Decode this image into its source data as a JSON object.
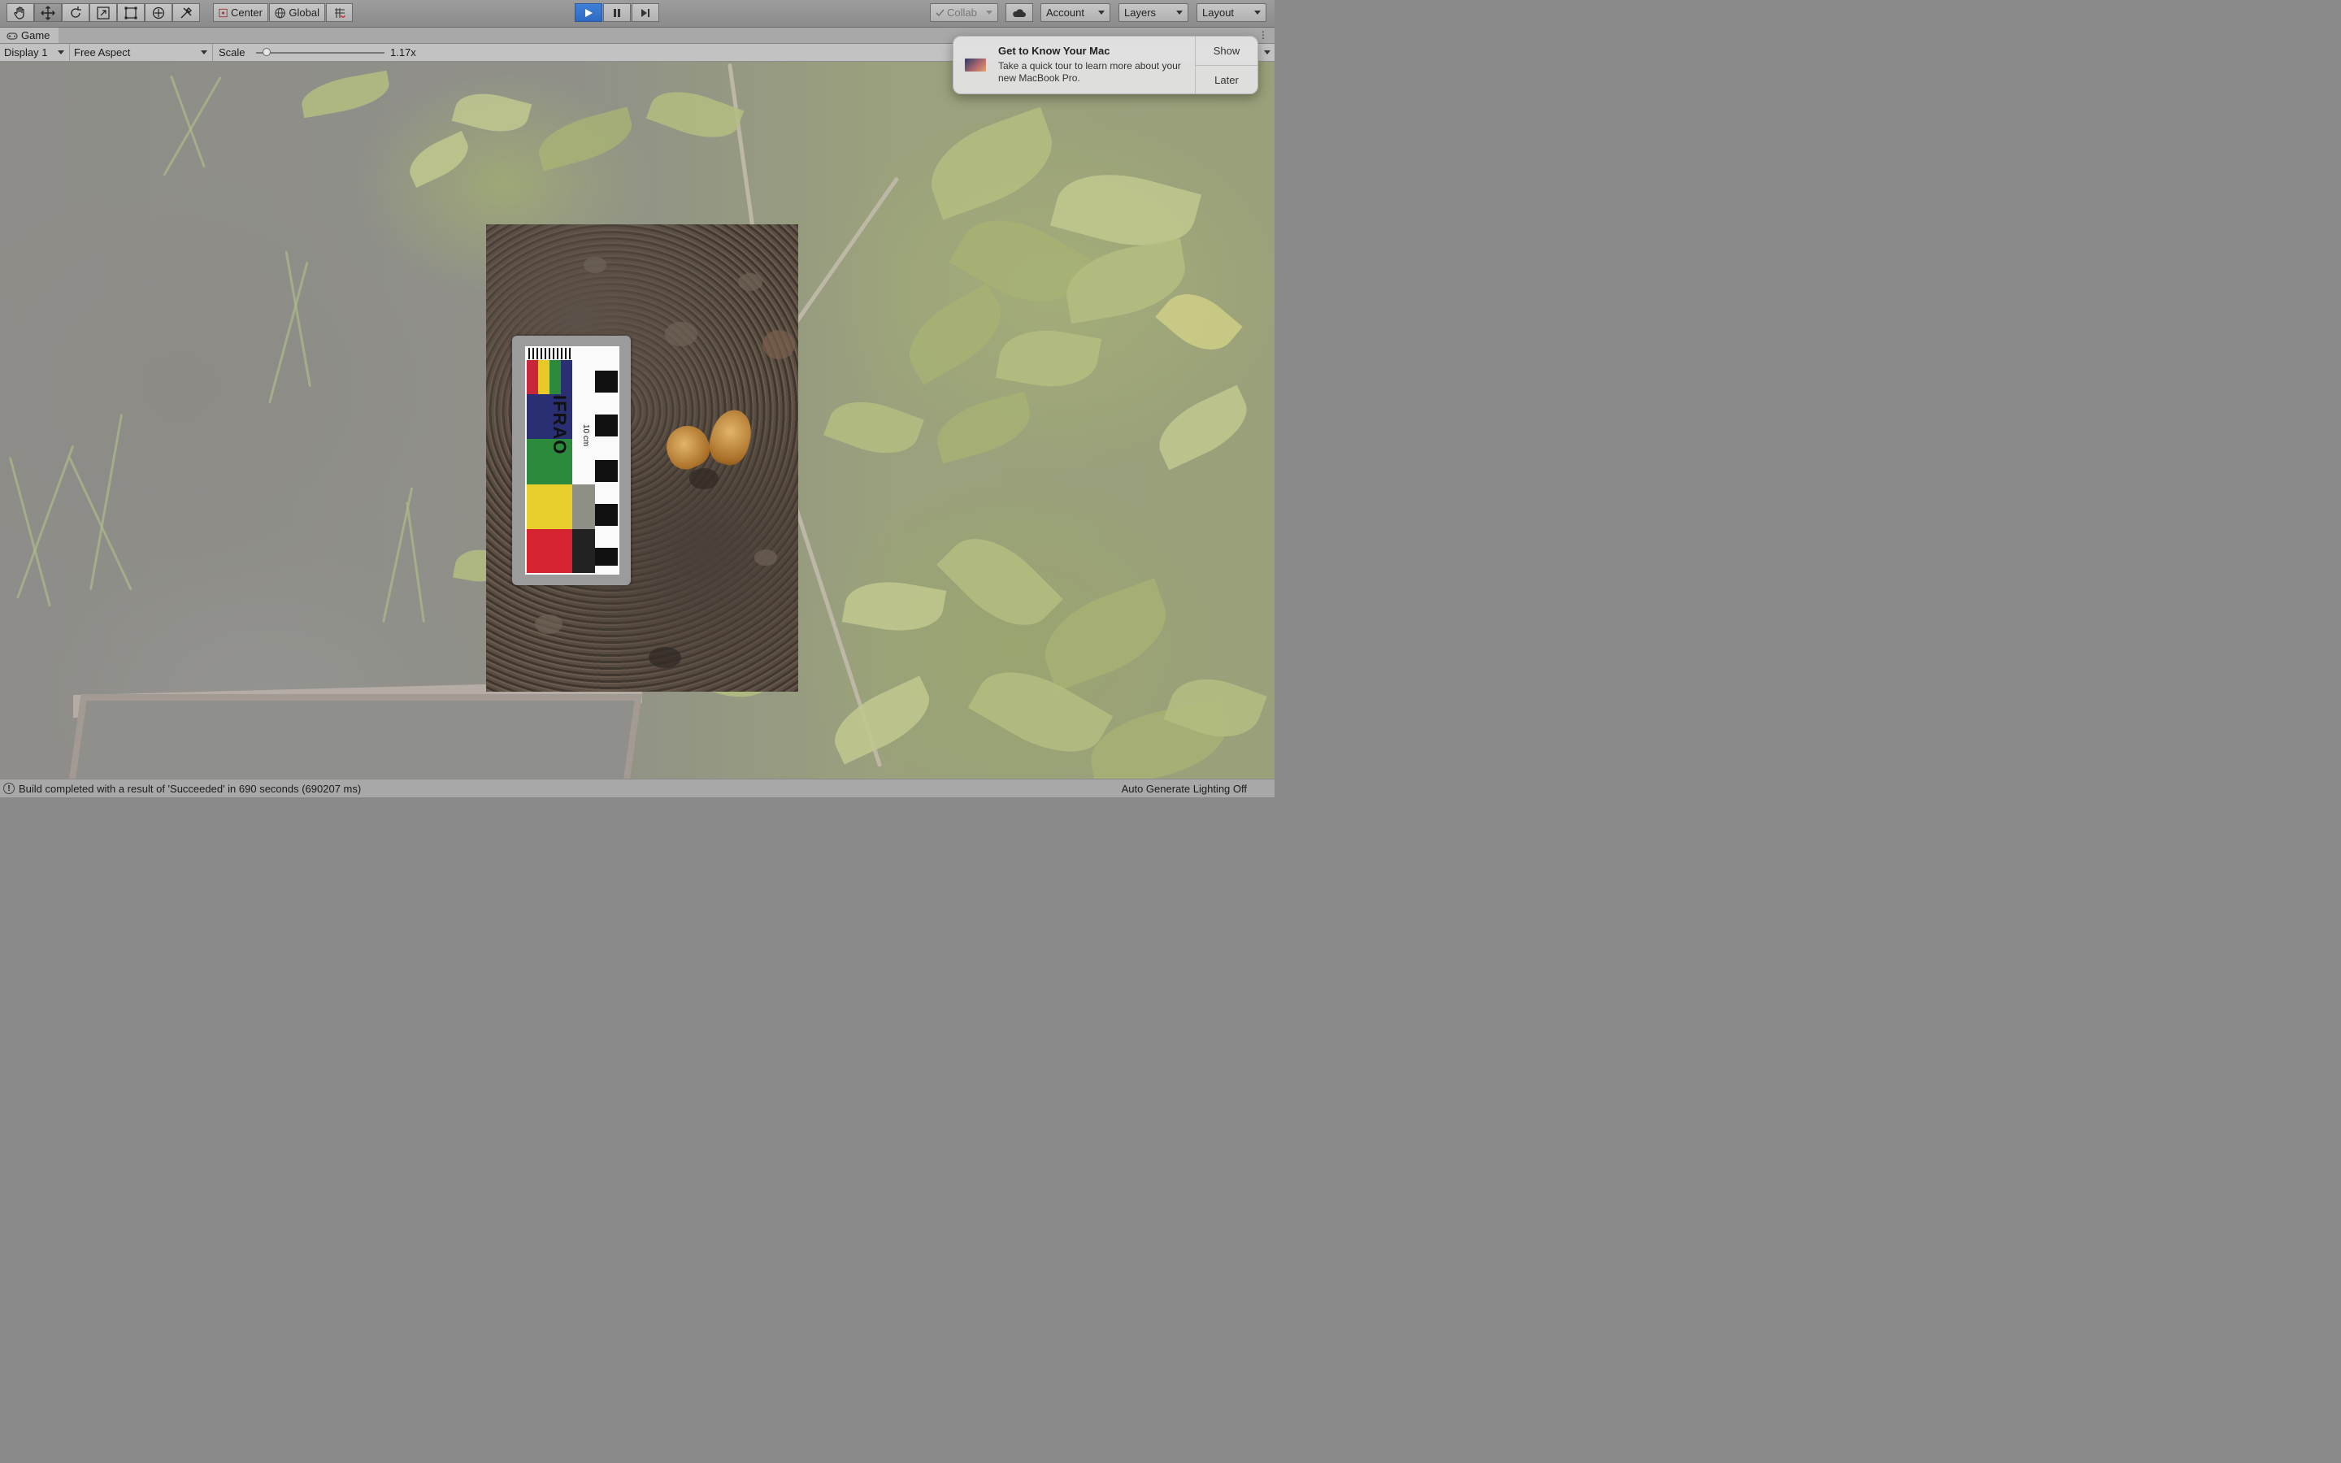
{
  "toolbar": {
    "tools": [
      "hand-tool",
      "move-tool",
      "rotate-tool",
      "scale-tool",
      "rect-tool",
      "transform-tool",
      "custom-tool"
    ],
    "pivot_label": "Center",
    "space_label": "Global",
    "collab_label": "Collab",
    "account_label": "Account",
    "layers_label": "Layers",
    "layout_label": "Layout"
  },
  "tab": {
    "label": "Game"
  },
  "gamebar": {
    "display": "Display 1",
    "aspect": "Free Aspect",
    "scale_label": "Scale",
    "scale_value": "1.17x",
    "scale_fraction": 0.08
  },
  "photo": {
    "card_text": "IFRAO",
    "card_sub": "10 cm",
    "colors": [
      "#c8263a",
      "#e9c928",
      "#2c8a3c",
      "#2a2e73",
      "#e9cf2e",
      "#d5232f",
      "#8e9086"
    ]
  },
  "notification": {
    "title": "Get to Know Your Mac",
    "body": "Take a quick tour to learn more about your new MacBook Pro.",
    "show_label": "Show",
    "later_label": "Later"
  },
  "status": {
    "message": "Build completed with a result of 'Succeeded' in 690 seconds (690207 ms)",
    "right_text": "Auto Generate Lighting Off"
  },
  "accent": "#2f6bc4"
}
